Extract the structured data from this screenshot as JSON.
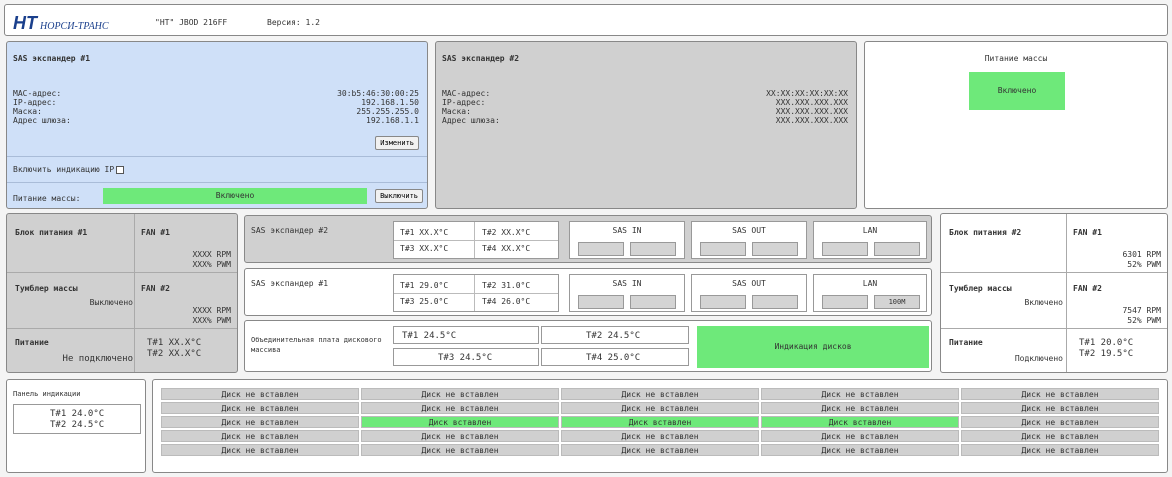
{
  "header": {
    "logo_mark": "HT",
    "logo_text": "НОРСИ-ТРАНС",
    "product": "\"НТ\" JBOD 216FF",
    "version": "Версия: 1.2"
  },
  "sas_exp_1_top": {
    "title": "SAS экспандер #1",
    "mac_label": "MAC-адрес:",
    "mac": "30:b5:46:30:00:25",
    "ip_label": "IP-адрес:",
    "ip": "192.168.1.50",
    "mask_label": "Маска:",
    "mask": "255.255.255.0",
    "gw_label": "Адрес шлюза:",
    "gw": "192.168.1.1",
    "change_button": "Изменить",
    "ip_indication_label": "Включить индикацию IP",
    "power_label": "Питание массы:",
    "power_state": "Включено",
    "power_off_button": "Выключить"
  },
  "sas_exp_2_top": {
    "title": "SAS экспандер #2",
    "mac_label": "MAC-адрес:",
    "mac": "XX:XX:XX:XX:XX:XX",
    "ip_label": "IP-адрес:",
    "ip": "XXX.XXX.XXX.XXX",
    "mask_label": "Маска:",
    "mask": "XXX.XXX.XXX.XXX",
    "gw_label": "Адрес шлюза:",
    "gw": "XXX.XXX.XXX.XXX"
  },
  "array_power": {
    "title": "Питание массы",
    "state": "Включено"
  },
  "psu1": {
    "title": "Блок питания #1",
    "fan1_label": "FAN #1",
    "fan1_rpm": "XXXX RPM",
    "fan1_pwm": "XXX% PWM",
    "switch_title": "Тумблер массы",
    "switch_state": "Выключено",
    "fan2_label": "FAN #2",
    "fan2_rpm": "XXXX RPM",
    "fan2_pwm": "XXX% PWM",
    "power_title": "Питание",
    "power_state": "Не подключено",
    "t1": "T#1  XX.X°C",
    "t2": "T#2  XX.X°C"
  },
  "psu2": {
    "title": "Блок питания #2",
    "fan1_label": "FAN #1",
    "fan1_rpm": "6301 RPM",
    "fan1_pwm": "52% PWM",
    "switch_title": "Тумблер массы",
    "switch_state": "Включено",
    "fan2_label": "FAN #2",
    "fan2_rpm": "7547 RPM",
    "fan2_pwm": "52% PWM",
    "power_title": "Питание",
    "power_state": "Подключено",
    "t1": "T#1  20.0°C",
    "t2": "T#2  19.5°C"
  },
  "exp2_row": {
    "title": "SAS экспандер #2",
    "t1": "T#1  XX.X°C",
    "t2": "T#2  XX.X°C",
    "t3": "T#3  XX.X°C",
    "t4": "T#4  XX.X°C",
    "sas_in": "SAS IN",
    "sas_out": "SAS OUT",
    "lan": "LAN"
  },
  "exp1_row": {
    "title": "SAS экспандер #1",
    "t1": "T#1  29.0°C",
    "t2": "T#2  31.0°C",
    "t3": "T#3  25.0°C",
    "t4": "T#4  26.0°C",
    "sas_in": "SAS IN",
    "sas_out": "SAS OUT",
    "lan": "LAN",
    "lan_speed": "100M"
  },
  "backplane": {
    "title": "Объединительная плата дискового массива",
    "t1": "T#1  24.5°C",
    "t2": "T#2  24.5°C",
    "t3": "T#3  24.5°C",
    "t4": "T#4  25.0°C",
    "indication_button": "Индикация дисков"
  },
  "indicator_panel": {
    "title": "Панель индикации",
    "t1": "T#1  24.0°C",
    "t2": "T#2  24.5°C"
  },
  "disks": {
    "empty": "Диск не вставлен",
    "inserted": "Диск вставлен",
    "rows": [
      [
        0,
        0,
        0,
        0,
        0
      ],
      [
        0,
        0,
        0,
        0,
        0
      ],
      [
        0,
        1,
        1,
        1,
        0
      ],
      [
        0,
        0,
        0,
        0,
        0
      ],
      [
        0,
        0,
        0,
        0,
        0
      ]
    ]
  },
  "colors": {
    "green": "#6ee97a",
    "blue_panel": "#cfe0f8",
    "gray_panel": "#d0d0d0"
  }
}
